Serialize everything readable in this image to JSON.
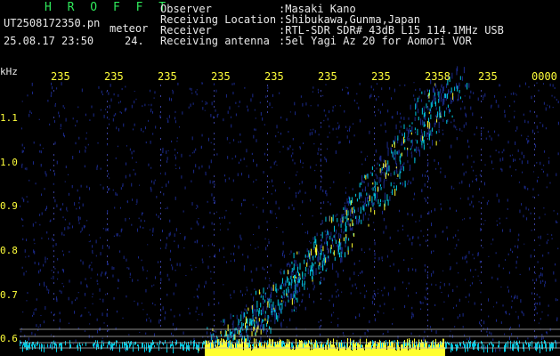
{
  "header": {
    "title": "H R O F F T",
    "filename": "UT2508172350.pn",
    "meteor_label": "meteor",
    "date_time": "25.08.17 23:50",
    "date_tail": "24.",
    "fields": [
      {
        "label": "Observer",
        "value": ":Masaki Kano"
      },
      {
        "label": "Receiving Location",
        "value": ":Shibukawa,Gunma,Japan"
      },
      {
        "label": "Receiver",
        "value": ":RTL-SDR SDR# 43dB L15 114.1MHz USB"
      },
      {
        "label": "Receiving antenna",
        "value": ":5el Yagi Az 20 for Aomori VOR"
      }
    ]
  },
  "plot": {
    "y_unit": "kHz",
    "y_ticks": [
      "1.1",
      "1.0",
      "0.9",
      "0.8",
      "0.7",
      "0.6"
    ],
    "x_ticks": [
      "235",
      "235",
      "235",
      "235",
      "235",
      "235",
      "235",
      "2358",
      "235",
      "0000"
    ]
  },
  "colors": {
    "background": "#000000",
    "text": "#e8e8e8",
    "title": "#2fe85a",
    "y_labels": "#ffff3a",
    "signal_low": "#1b2a8c",
    "signal_mid": "#00c8e0",
    "signal_high": "#ffff30"
  }
}
